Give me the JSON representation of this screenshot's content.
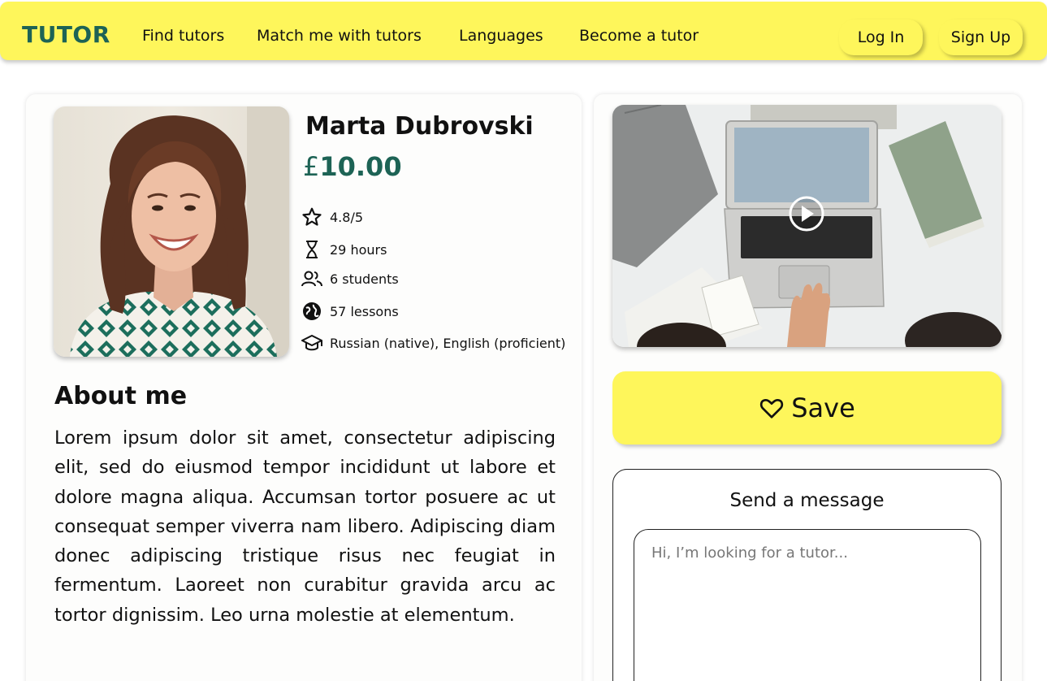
{
  "brand": {
    "logo": "TUTOR",
    "logo_color": "#1d6355",
    "accent": "#fef65b"
  },
  "nav": {
    "links": [
      "Find tutors",
      "Match me with tutors",
      "Languages",
      "Become a tutor"
    ],
    "login": "Log In",
    "signup": "Sign Up"
  },
  "tutor": {
    "name": "Marta Dubrovski",
    "currency": "£",
    "price": "10.00",
    "stats": [
      {
        "icon": "star-icon",
        "text": "4.8/5"
      },
      {
        "icon": "hourglass-icon",
        "text": "29 hours"
      },
      {
        "icon": "users-icon",
        "text": "6 students"
      },
      {
        "icon": "globe-icon",
        "text": "57 lessons"
      },
      {
        "icon": "graduation-cap-icon",
        "text": "Russian (native), English (proficient)"
      }
    ]
  },
  "about": {
    "title": "About me",
    "text": "Lorem ipsum dolor sit amet, consectetur adipiscing elit, sed do eiusmod tempor incididunt ut labore et dolore magna aliqua. Accumsan tortor posuere ac ut consequat semper viverra nam libero. Adipiscing diam donec adipiscing tristique risus nec feugiat in fermentum. Laoreet non curabitur gravida arcu ac tortor dignissim. Leo urna molestie at elementum."
  },
  "save": {
    "label": "Save",
    "icon": "heart-icon"
  },
  "message": {
    "title": "Send a message",
    "placeholder": "Hi, I’m looking for a tutor..."
  }
}
